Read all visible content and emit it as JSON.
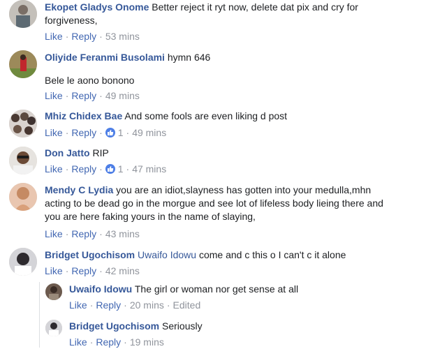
{
  "comments": [
    {
      "author": "Ekopet Gladys Onome",
      "text": "Better reject it ryt now, delete dat pix and cry for",
      "text2": "forgiveness,",
      "like": "Like",
      "reply": "Reply",
      "time": "53 mins"
    },
    {
      "author": "Oliyide Feranmi Busolami",
      "text": "hymn 646",
      "text2": "Bele le aono bonono",
      "like": "Like",
      "reply": "Reply",
      "time": "49 mins"
    },
    {
      "author": "Mhiz Chidex Bae",
      "text": "And some fools are even liking d post",
      "like": "Like",
      "reply": "Reply",
      "reactions": "1",
      "time": "49 mins"
    },
    {
      "author": "Don Jatto",
      "text": "RIP",
      "like": "Like",
      "reply": "Reply",
      "reactions": "1",
      "time": "47 mins"
    },
    {
      "author": "Mendy C Lydia",
      "text": "you are an idiot,slayness has gotten into your medulla,mhn",
      "text2": "acting to be dead go in the morgue and see lot of lifeless body lieing there and",
      "text3": "you are here faking yours in the name of slaying,",
      "like": "Like",
      "reply": "Reply",
      "time": "43 mins"
    },
    {
      "author": "Bridget Ugochisom",
      "mention": "Uwaifo Idowu",
      "text": "come and c this o I can't c it alone",
      "like": "Like",
      "reply": "Reply",
      "time": "42 mins"
    }
  ],
  "replies": [
    {
      "author": "Uwaifo Idowu",
      "text": "The girl or woman nor get sense at all",
      "like": "Like",
      "reply": "Reply",
      "time": "20 mins",
      "edited": "Edited"
    },
    {
      "author": "Bridget Ugochisom",
      "text": "Seriously",
      "like": "Like",
      "reply": "Reply",
      "time": "19 mins"
    }
  ],
  "colors": {
    "link": "#365899",
    "action": "#4267b2",
    "meta": "#90949c",
    "reaction": "#4e7fe6"
  }
}
